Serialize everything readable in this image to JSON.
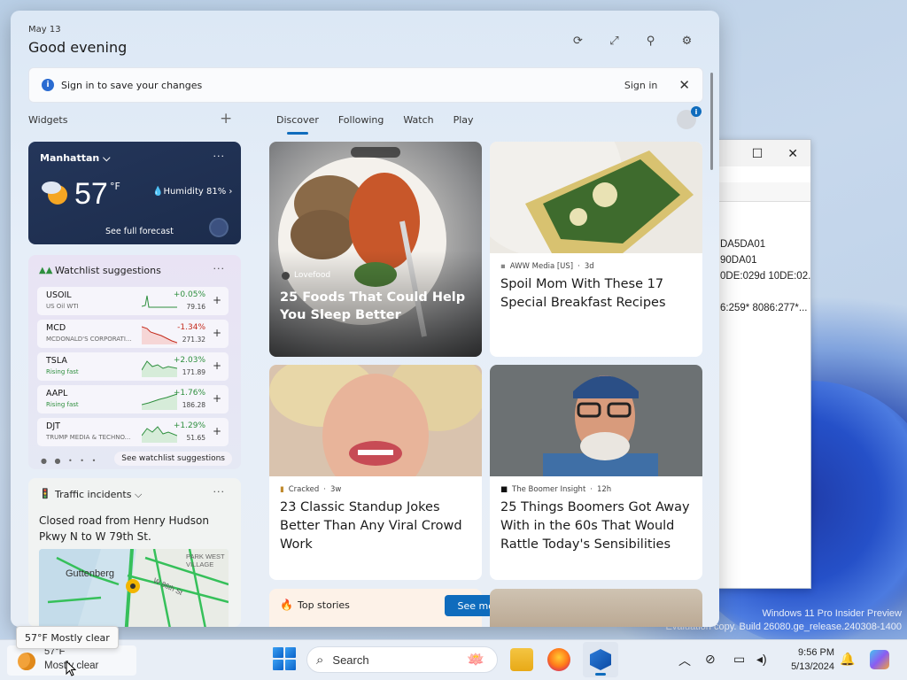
{
  "panel": {
    "date": "May 13",
    "greeting": "Good evening",
    "header_icons": [
      "refresh-icon",
      "expand-icon",
      "personalize-icon",
      "settings-icon"
    ],
    "signin_bar": {
      "message": "Sign in to save your changes",
      "action": "Sign in"
    },
    "widgets_label": "Widgets",
    "tabs": [
      "Discover",
      "Following",
      "Watch",
      "Play"
    ],
    "active_tab": "Discover"
  },
  "weather": {
    "location": "Manhattan",
    "temperature": "57",
    "unit": "°F",
    "humidity": "Humidity 81%",
    "forecast_link": "See full forecast"
  },
  "watchlist": {
    "title": "Watchlist suggestions",
    "stocks": [
      {
        "symbol": "USOIL",
        "sub": "US Oil WTI",
        "change": "+0.05%",
        "price": "79.16",
        "up": true
      },
      {
        "symbol": "MCD",
        "sub": "MCDONALD'S CORPORATI...",
        "change": "-1.34%",
        "price": "271.32",
        "up": false
      },
      {
        "symbol": "TSLA",
        "sub": "Rising fast",
        "change": "+2.03%",
        "price": "171.89",
        "up": true
      },
      {
        "symbol": "AAPL",
        "sub": "Rising fast",
        "change": "+1.76%",
        "price": "186.28",
        "up": true
      },
      {
        "symbol": "DJT",
        "sub": "TRUMP MEDIA & TECHNO...",
        "change": "+1.29%",
        "price": "51.65",
        "up": true
      }
    ],
    "see_link": "See watchlist suggestions"
  },
  "traffic": {
    "title": "Traffic incidents",
    "description": "Closed road from Henry Hudson Pkwy N to W 79th St.",
    "map_labels": [
      "PARK WEST VILLAGE",
      "Guttenberg",
      "W 86th St"
    ]
  },
  "feed": {
    "hero": {
      "source": "Lovefood",
      "title": "25 Foods That Could Help You Sleep Better"
    },
    "card1": {
      "source": "AWW Media [US]",
      "age": "3d",
      "title": "Spoil Mom With These 17 Special Breakfast Recipes"
    },
    "card2": {
      "source": "Cracked",
      "age": "3w",
      "title": "23 Classic Standup Jokes Better Than Any Viral Crowd Work"
    },
    "card3": {
      "source": "The Boomer Insight",
      "age": "12h",
      "title": "25 Things Boomers Got Away With in the 60s That Would Rattle Today's Sensibilities"
    },
    "top_stories": {
      "label": "Top stories",
      "button": "See more"
    }
  },
  "background_window": {
    "lines": [
      "DA5DA01",
      "90DA01",
      "0DE:029d 10DE:02...",
      "6:259* 8086:277*..."
    ]
  },
  "watermark": {
    "line1": "Windows 11 Pro Insider Preview",
    "line2": "Evaluation copy. Build 26080.ge_release.240308-1400"
  },
  "tooltip": "57°F Mostly clear",
  "taskbar": {
    "weather_temp": "57°F",
    "weather_cond": "Mostly clear",
    "search_placeholder": "Search",
    "time": "9:56 PM",
    "date": "5/13/2024",
    "apps": [
      "start-icon",
      "file-explorer-icon",
      "firefox-icon",
      "app-icon"
    ]
  }
}
